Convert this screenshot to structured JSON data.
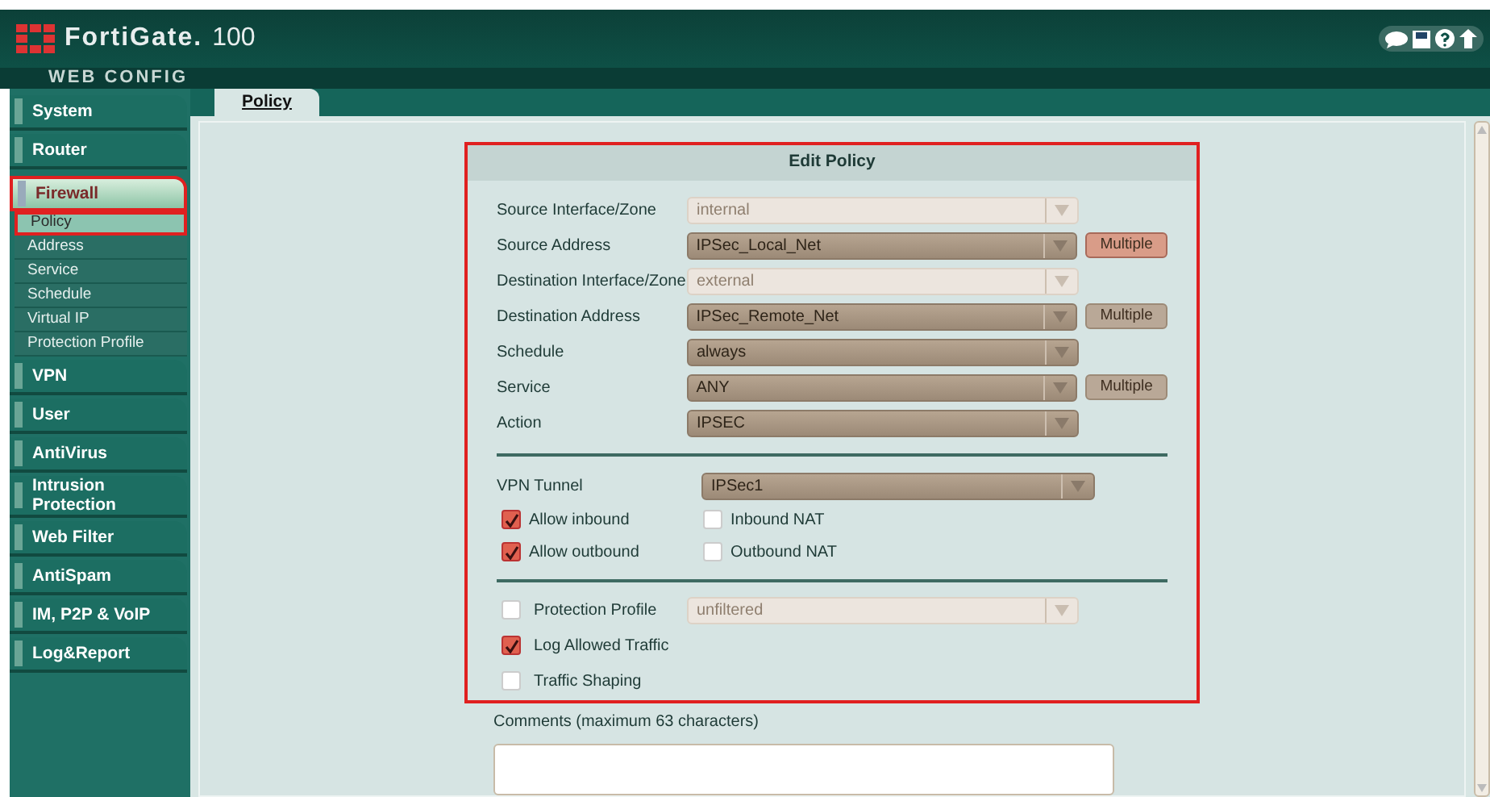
{
  "header": {
    "logo_text": "FortiGate.",
    "model": "100",
    "subtitle": "WEB CONFIG"
  },
  "sidebar": {
    "items": [
      {
        "label": "System",
        "expanded": false
      },
      {
        "label": "Router",
        "expanded": false
      },
      {
        "label": "Firewall",
        "expanded": true,
        "children": [
          {
            "label": "Policy",
            "selected": true
          },
          {
            "label": "Address",
            "selected": false
          },
          {
            "label": "Service",
            "selected": false
          },
          {
            "label": "Schedule",
            "selected": false
          },
          {
            "label": "Virtual IP",
            "selected": false
          },
          {
            "label": "Protection Profile",
            "selected": false
          }
        ]
      },
      {
        "label": "VPN",
        "expanded": false
      },
      {
        "label": "User",
        "expanded": false
      },
      {
        "label": "AntiVirus",
        "expanded": false
      },
      {
        "label": "Intrusion Protection",
        "expanded": false
      },
      {
        "label": "Web Filter",
        "expanded": false
      },
      {
        "label": "AntiSpam",
        "expanded": false
      },
      {
        "label": "IM, P2P & VoIP",
        "expanded": false
      },
      {
        "label": "Log&Report",
        "expanded": false
      }
    ]
  },
  "tabs": [
    {
      "label": "Policy",
      "selected": true
    }
  ],
  "form": {
    "title": "Edit Policy",
    "fields": [
      {
        "label": "Source Interface/Zone",
        "value": "internal",
        "disabled": true
      },
      {
        "label": "Source Address",
        "value": "IPSec_Local_Net",
        "disabled": false,
        "button": "Multiple",
        "button_focused": true
      },
      {
        "label": "Destination Interface/Zone",
        "value": "external",
        "disabled": true
      },
      {
        "label": "Destination Address",
        "value": "IPSec_Remote_Net",
        "disabled": false,
        "button": "Multiple",
        "button_focused": false
      },
      {
        "label": "Schedule",
        "value": "always",
        "disabled": false
      },
      {
        "label": "Service",
        "value": "ANY",
        "disabled": false,
        "button": "Multiple",
        "button_focused": false
      },
      {
        "label": "Action",
        "value": "IPSEC",
        "disabled": false
      }
    ],
    "vpn": {
      "label": "VPN Tunnel",
      "value": "IPSec1",
      "options": [
        {
          "label": "Allow inbound",
          "checked": true
        },
        {
          "label": "Inbound NAT",
          "checked": false
        },
        {
          "label": "Allow outbound",
          "checked": true
        },
        {
          "label": "Outbound NAT",
          "checked": false
        }
      ]
    },
    "extras": [
      {
        "label": "Protection Profile",
        "checked": false,
        "value": "unfiltered"
      },
      {
        "label": "Log Allowed Traffic",
        "checked": true
      },
      {
        "label": "Traffic Shaping",
        "checked": false
      }
    ],
    "comments_label": "Comments (maximum 63 characters)"
  }
}
